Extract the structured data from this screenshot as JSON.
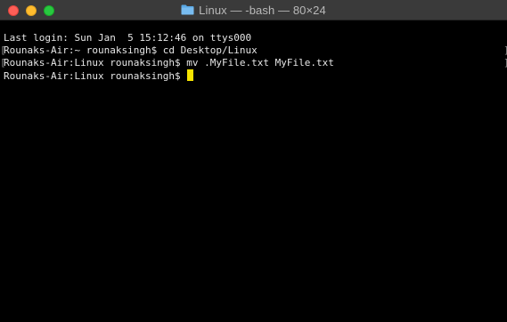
{
  "window": {
    "title": "Linux — -bash — 80×24",
    "title_icon": "folder-icon"
  },
  "terminal": {
    "lines": [
      "Last login: Sun Jan  5 15:12:46 on ttys000",
      "Rounaks-Air:~ rounaksingh$ cd Desktop/Linux",
      "Rounaks-Air:Linux rounaksingh$ mv .MyFile.txt MyFile.txt",
      "Rounaks-Air:Linux rounaksingh$ "
    ],
    "cursor_color": "#f7e400",
    "background": "#000000",
    "foreground": "#e6e6e6"
  }
}
